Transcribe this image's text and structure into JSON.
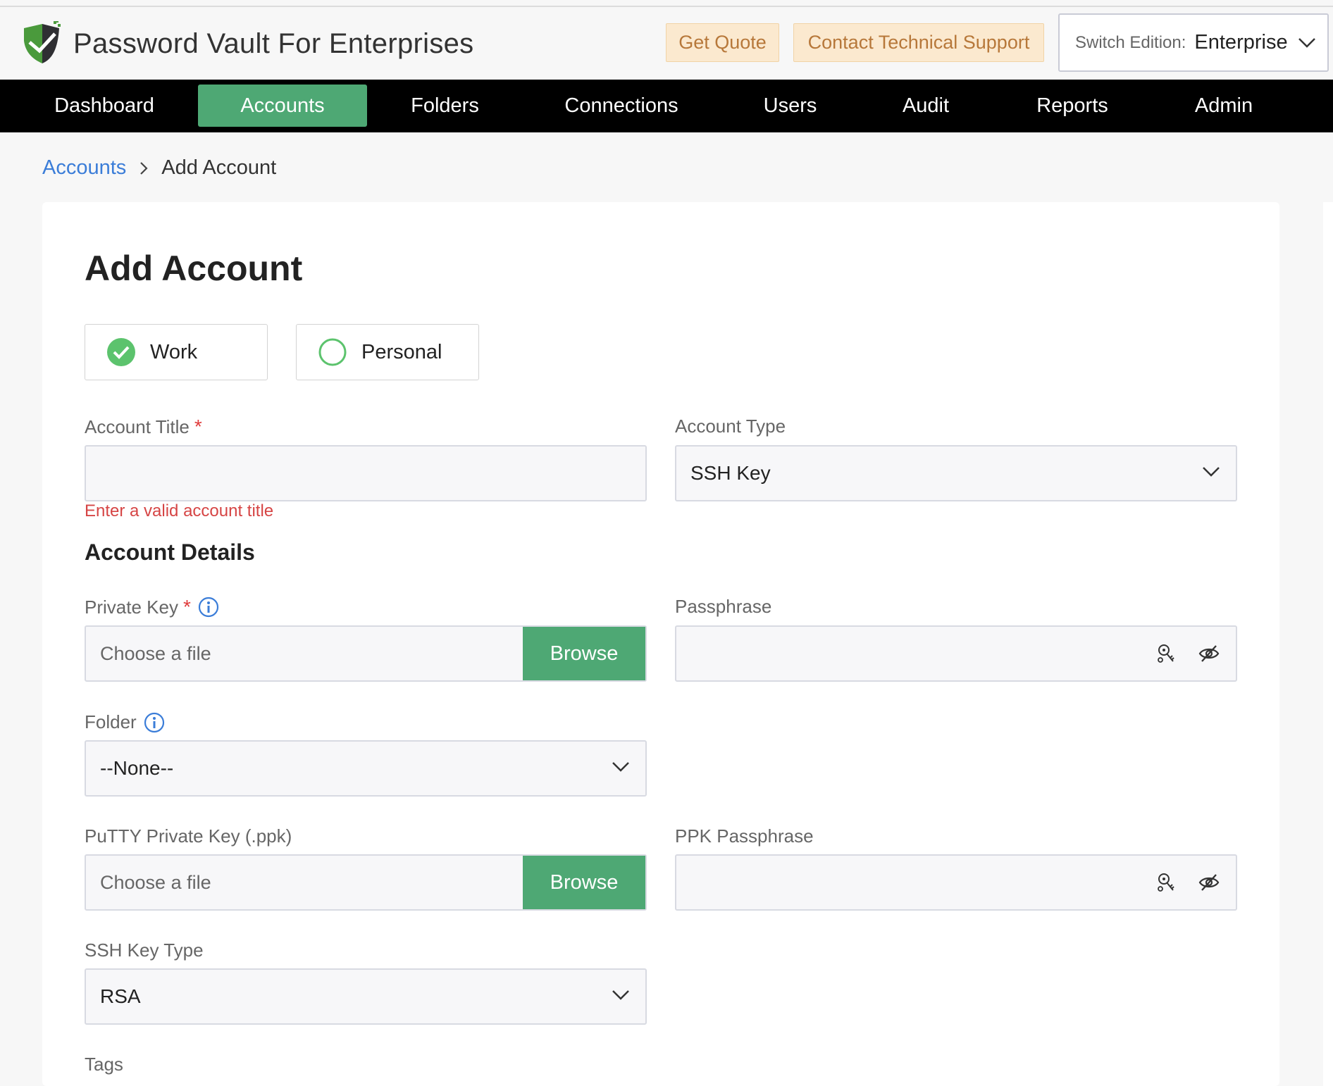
{
  "header": {
    "app_title": "Password Vault For Enterprises",
    "get_quote": "Get Quote",
    "contact_support": "Contact Technical Support",
    "edition_label": "Switch Edition:",
    "edition_value": "Enterprise"
  },
  "nav": {
    "items": [
      "Dashboard",
      "Accounts",
      "Folders",
      "Connections",
      "Users",
      "Audit",
      "Reports",
      "Admin"
    ],
    "active": "Accounts"
  },
  "breadcrumb": {
    "parent": "Accounts",
    "current": "Add Account"
  },
  "form": {
    "title": "Add Account",
    "ownership": {
      "work": "Work",
      "personal": "Personal",
      "selected": "Work"
    },
    "account_title": {
      "label": "Account Title",
      "required_mark": "*",
      "value": "",
      "error": "Enter a valid account title"
    },
    "account_type": {
      "label": "Account Type",
      "value": "SSH Key"
    },
    "section_details": "Account Details",
    "private_key": {
      "label": "Private Key",
      "required_mark": "*",
      "placeholder": "Choose a file",
      "button": "Browse"
    },
    "passphrase": {
      "label": "Passphrase",
      "value": ""
    },
    "folder": {
      "label": "Folder",
      "value": "--None--"
    },
    "putty_key": {
      "label": "PuTTY Private Key (.ppk)",
      "placeholder": "Choose a file",
      "button": "Browse"
    },
    "ppk_passphrase": {
      "label": "PPK Passphrase",
      "value": ""
    },
    "ssh_key_type": {
      "label": "SSH Key Type",
      "value": "RSA"
    },
    "tags": {
      "label": "Tags"
    }
  },
  "colors": {
    "accent_green": "#4ea874",
    "nav_bg": "#000000",
    "link_blue": "#3b7dd8",
    "error_red": "#d64545",
    "header_button_bg": "#fbe9cf",
    "header_button_text": "#b7783a"
  },
  "icons": {
    "logo": "shield-check-logo",
    "chevron": "chevron-down-icon",
    "info": "info-icon",
    "key": "key-generator-icon",
    "eye": "eye-slash-icon",
    "check": "check-circle-icon"
  }
}
